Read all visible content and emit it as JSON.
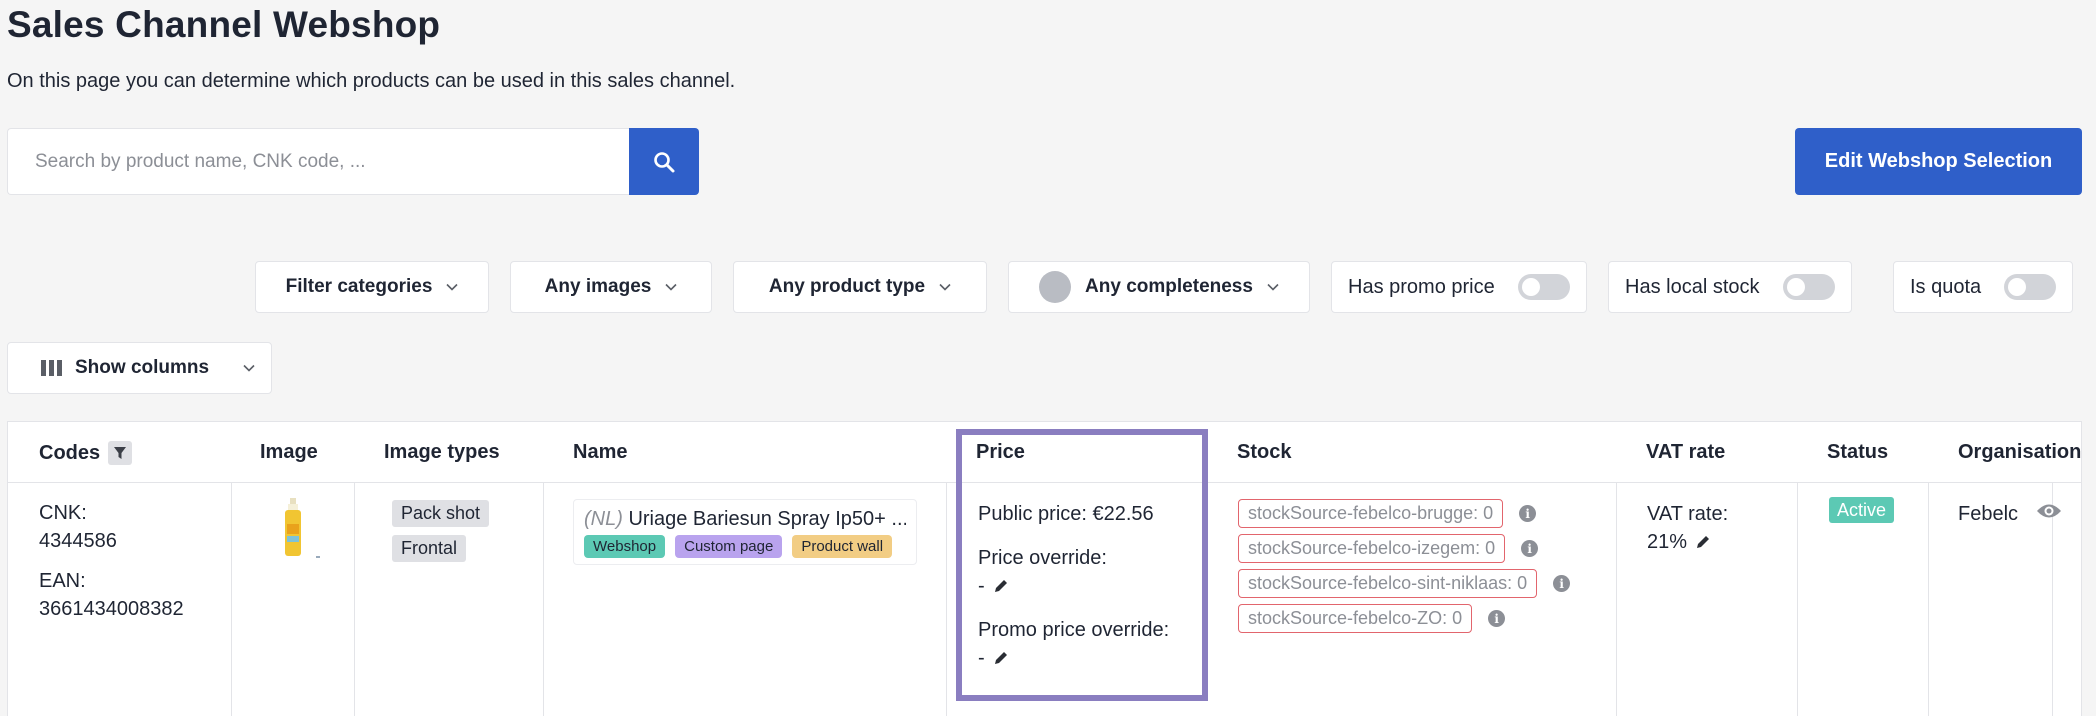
{
  "header": {
    "title": "Sales Channel Webshop",
    "description": "On this page you can determine which products can be used in this sales channel."
  },
  "search": {
    "placeholder": "Search by product name, CNK code, ..."
  },
  "actions": {
    "edit_selection": "Edit Webshop Selection"
  },
  "filters": {
    "categories": "Filter categories",
    "images": "Any images",
    "product_type": "Any product type",
    "completeness": "Any completeness",
    "promo_price": "Has promo price",
    "local_stock": "Has local stock",
    "quota": "Is quota",
    "show_columns": "Show columns"
  },
  "table": {
    "columns": [
      "Codes",
      "Image",
      "Image types",
      "Name",
      "Price",
      "Stock",
      "VAT rate",
      "Status",
      "Organisation"
    ],
    "row": {
      "cnk_label": "CNK:",
      "cnk": "4344586",
      "ean_label": "EAN:",
      "ean": "3661434008382",
      "image_types": [
        "Pack shot",
        "Frontal"
      ],
      "name_prefix": "(NL)",
      "name": "Uriage Bariesun Spray Ip50+ ...",
      "tags": [
        {
          "label": "Webshop",
          "color": "#5cc9b4"
        },
        {
          "label": "Custom page",
          "color": "#b9a3ee"
        },
        {
          "label": "Product wall",
          "color": "#f2cd84"
        }
      ],
      "public_price": "Public price: €22.56",
      "price_override_label": "Price override:",
      "price_override_value": "-",
      "promo_override_label": "Promo price override:",
      "promo_override_value": "-",
      "stock": [
        "stockSource-febelco-brugge: 0",
        "stockSource-febelco-izegem: 0",
        "stockSource-febelco-sint-niklaas: 0",
        "stockSource-febelco-ZO: 0"
      ],
      "vat_label": "VAT rate:",
      "vat_value": "21%",
      "status": "Active",
      "organisation": "Febelco"
    }
  },
  "colors": {
    "primary": "#2f5fc9",
    "highlight": "#8a7ec0",
    "status_active": "#5cc9b4",
    "stock_border": "#e2656d"
  }
}
